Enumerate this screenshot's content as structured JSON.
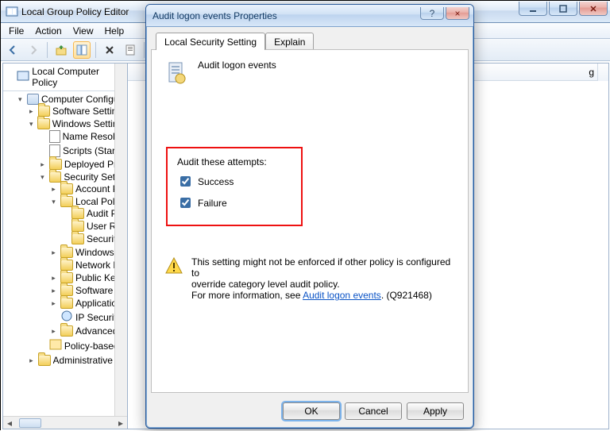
{
  "window": {
    "title": "Local Group Policy Editor",
    "menu": {
      "file": "File",
      "action": "Action",
      "view": "View",
      "help": "Help"
    }
  },
  "toolbar": {
    "back": "back",
    "forward": "forward",
    "up": "up",
    "show": "show-hide",
    "delete": "delete",
    "props": "properties",
    "help": "help"
  },
  "tree": {
    "header": "Local Computer Policy",
    "root": "Computer Configura",
    "software": "Software Settings",
    "windows": "Windows Settings",
    "name_res": "Name Resoluti",
    "scripts": "Scripts (Startu",
    "deployed": "Deployed Prin",
    "security": "Security Settin",
    "account": "Account P",
    "local_pol": "Local Polic",
    "audit": "Audit P",
    "user_rights": "User Ri",
    "sec_opt": "Securit",
    "win_logs": "Windows l",
    "network": "Network L",
    "public_key": "Public Key",
    "software_r": "Software R",
    "app_ctrl": "Applicatio",
    "ip_sec": "IP Security",
    "advanced": "Advanced",
    "policy_based": "Policy-based (",
    "admin_t": "Administrative Te"
  },
  "content": {
    "header_text": "g"
  },
  "dialog": {
    "title": "Audit logon events Properties",
    "tabs": {
      "local": "Local Security Setting",
      "explain": "Explain"
    },
    "policy_name": "Audit logon events",
    "group_label": "Audit these attempts:",
    "success": "Success",
    "failure": "Failure",
    "success_checked": true,
    "failure_checked": true,
    "warn_line1": "This setting might not be enforced if other policy is configured to",
    "warn_line2": "override category level audit policy.",
    "warn_line3a": "For more information, see ",
    "warn_link": "Audit logon events",
    "warn_line3b": ". (Q921468)",
    "ok": "OK",
    "cancel": "Cancel",
    "apply": "Apply",
    "help_tip": "?",
    "close_tip": "×"
  }
}
